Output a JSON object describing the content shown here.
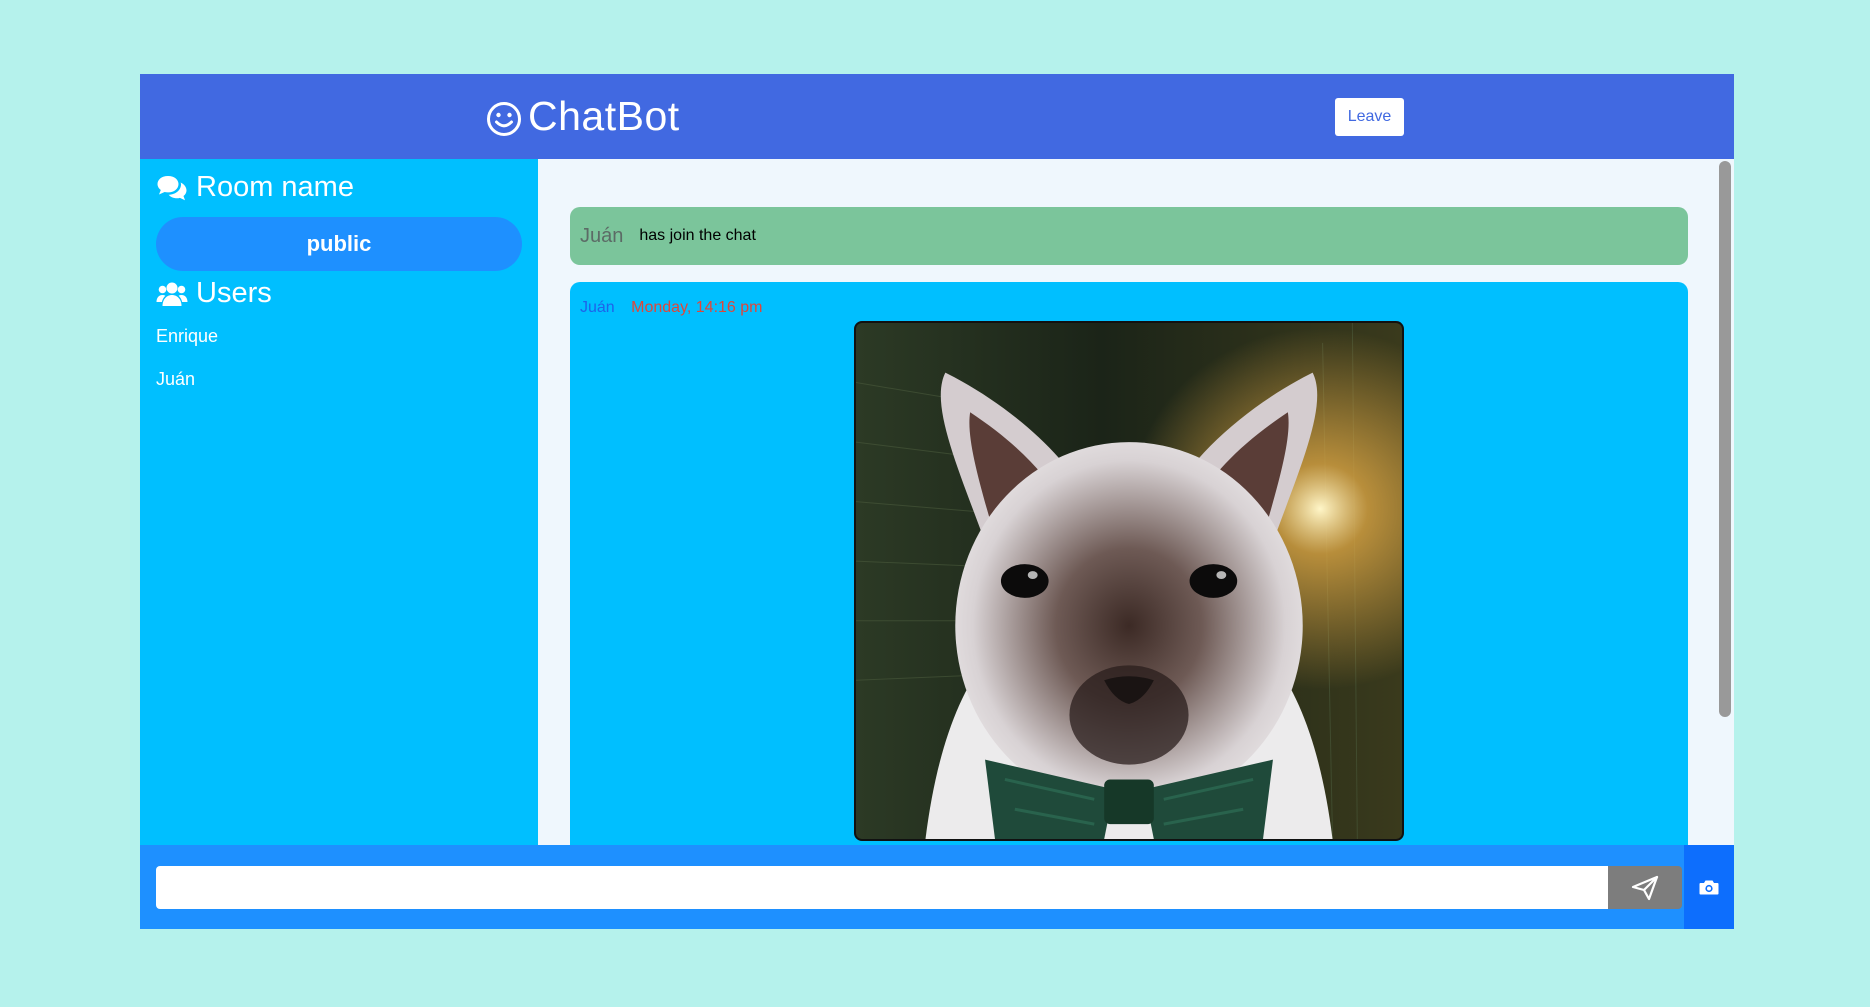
{
  "header": {
    "app_title": "ChatBot",
    "brand_icon": "smiley-icon",
    "leave_label": "Leave"
  },
  "sidebar": {
    "room_heading": "Room name",
    "room_icon": "comments-icon",
    "room_name": "public",
    "users_heading": "Users",
    "users_icon": "users-icon",
    "users": [
      "Enrique",
      "Juán"
    ]
  },
  "chat": {
    "messages": [
      {
        "type": "system",
        "user": "Juán",
        "text": "has join the chat"
      },
      {
        "type": "image",
        "user": "Juán",
        "time": "Monday, 14:16 pm",
        "image": "cat-with-bowtie-photo"
      }
    ]
  },
  "composer": {
    "input_value": "",
    "input_placeholder": "",
    "send_icon": "paper-plane-icon",
    "camera_icon": "camera-icon"
  },
  "colors": {
    "page_background": "#b5f2ec",
    "header": "#4169e1",
    "sidebar": "#00bfff",
    "room_pill": "#1e90ff",
    "join_message": "#7bc59b",
    "image_message": "#00bfff",
    "footer": "#1e90ff",
    "camera_button": "#0d6efd",
    "send_button": "#7d7d7d",
    "message_time": "#e0463a",
    "message_user": "#1e63e9"
  }
}
